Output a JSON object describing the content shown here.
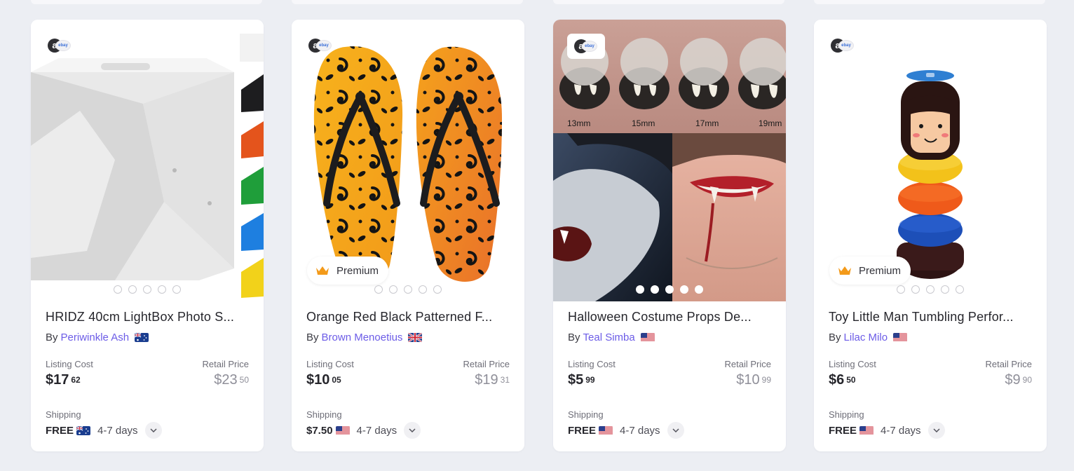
{
  "source_logo_text": "ebay",
  "premium_label": "Premium",
  "by_prefix": "By",
  "labels": {
    "listing_cost": "Listing Cost",
    "retail_price": "Retail Price",
    "shipping": "Shipping"
  },
  "icons": {
    "crown": "crown-icon",
    "chevron": "chevron-down-icon",
    "source": "source-marketplace-icon"
  },
  "colors": {
    "seller_link": "#6c5ce7",
    "crown": "#f39a1a",
    "background": "#eceef3"
  },
  "products": [
    {
      "title": "HRIDZ 40cm LightBox Photo S...",
      "seller": "Periwinkle Ash",
      "seller_flag": "AU",
      "listing_cost_whole": "$17",
      "listing_cost_cents": "62",
      "retail_whole": "$23",
      "retail_cents": "50",
      "shipping_cost": "FREE",
      "shipping_flag": "AU",
      "shipping_days": "4-7 days",
      "premium": false,
      "image_count": 5,
      "active_image": 1
    },
    {
      "title": "Orange Red Black Patterned F...",
      "seller": "Brown Menoetius",
      "seller_flag": "GB",
      "listing_cost_whole": "$10",
      "listing_cost_cents": "05",
      "retail_whole": "$19",
      "retail_cents": "31",
      "shipping_cost": "$7.50",
      "shipping_flag": "US",
      "shipping_days": "4-7 days",
      "premium": true,
      "image_count": 5,
      "active_image": 1
    },
    {
      "title": "Halloween Costume Props De...",
      "seller": "Teal Simba",
      "seller_flag": "US",
      "listing_cost_whole": "$5",
      "listing_cost_cents": "99",
      "retail_whole": "$10",
      "retail_cents": "99",
      "shipping_cost": "FREE",
      "shipping_flag": "US",
      "shipping_days": "4-7 days",
      "premium": false,
      "image_count": 5,
      "active_image": 1,
      "image_labels": [
        "13mm",
        "15mm",
        "17mm",
        "19mm"
      ]
    },
    {
      "title": "Toy Little Man Tumbling Perfor...",
      "seller": "Lilac Milo",
      "seller_flag": "US",
      "listing_cost_whole": "$6",
      "listing_cost_cents": "50",
      "retail_whole": "$9",
      "retail_cents": "90",
      "shipping_cost": "FREE",
      "shipping_flag": "US",
      "shipping_days": "4-7 days",
      "premium": true,
      "image_count": 5,
      "active_image": 1
    }
  ]
}
